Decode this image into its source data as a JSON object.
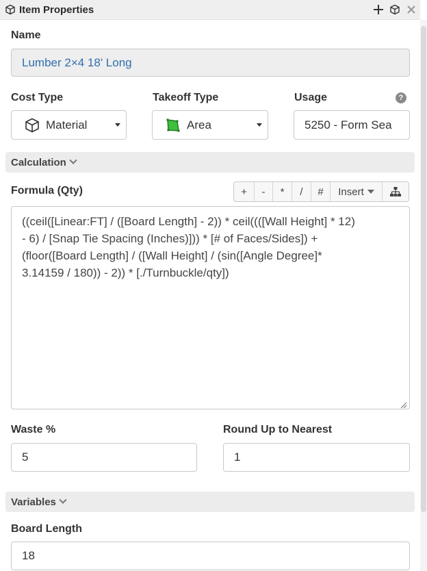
{
  "panel": {
    "title": "Item Properties",
    "icons": {
      "title": "cube-icon",
      "add": "plus-icon",
      "view": "cube-icon",
      "close": "close-icon"
    }
  },
  "name": {
    "label": "Name",
    "value": "Lumber 2×4 18' Long"
  },
  "cost_type": {
    "label": "Cost Type",
    "value": "Material",
    "icon": "cube-icon"
  },
  "takeoff_type": {
    "label": "Takeoff Type",
    "value": "Area",
    "icon": "area-polygon-icon",
    "icon_color": "#3fbf3f"
  },
  "usage": {
    "label": "Usage",
    "value": "5250 - Form Sea"
  },
  "calculation": {
    "label": "Calculation"
  },
  "formula": {
    "label": "Formula (Qty)",
    "toolbar": {
      "plus": "+",
      "minus": "-",
      "multiply": "*",
      "divide": "/",
      "hash": "#",
      "insert": "Insert"
    },
    "value": "((ceil([Linear:FT] / ([Board Length] - 2)) * ceil((([Wall Height] * 12)\n- 6) / [Snap Tie Spacing (Inches)])) * [# of Faces/Sides]) +\n(floor([Board Length] / ([Wall Height] / (sin([Angle Degree]*\n3.14159 / 180)) - 2)) * [./Turnbuckle/qty])"
  },
  "waste": {
    "label": "Waste %",
    "value": "5"
  },
  "round_up": {
    "label": "Round Up to Nearest",
    "value": "1"
  },
  "variables": {
    "label": "Variables"
  },
  "board_length": {
    "label": "Board Length",
    "value": "18"
  }
}
